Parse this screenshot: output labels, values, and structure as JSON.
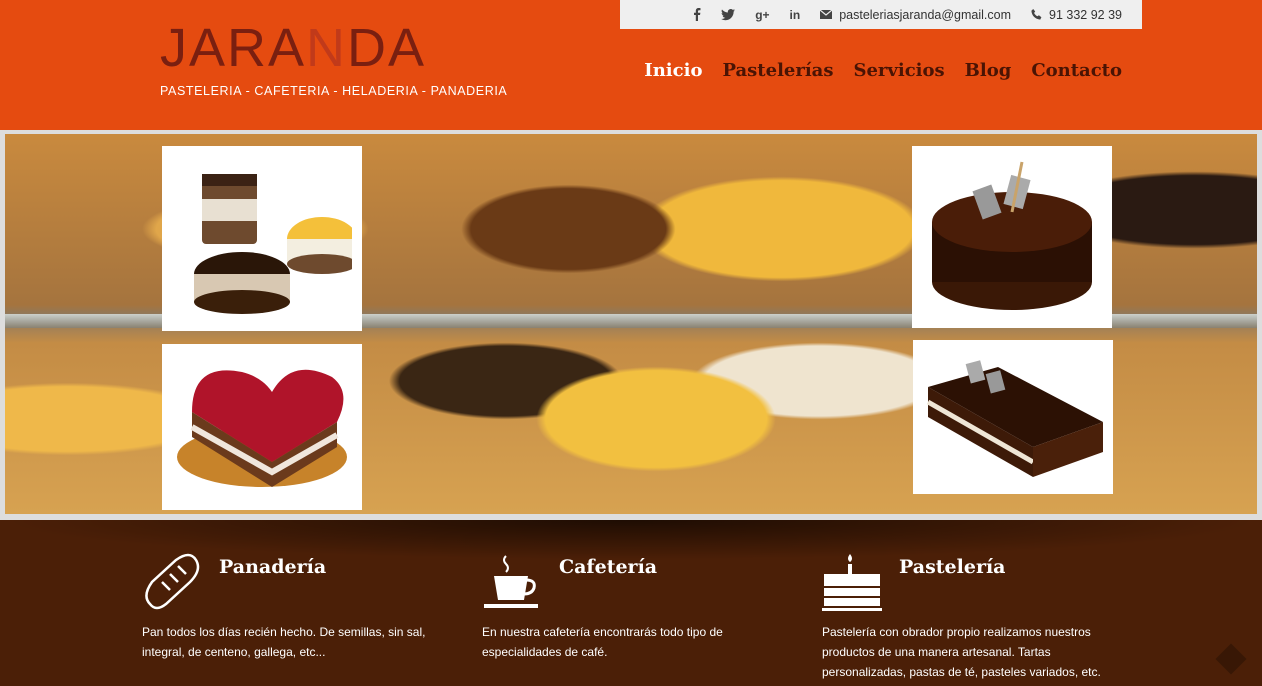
{
  "brand": {
    "name_left": "JARA",
    "name_mid": "N",
    "name_right": "DA",
    "tagline": "PASTELERIA - CAFETERIA - HELADERIA - PANADERIA"
  },
  "topbar": {
    "social": [
      "facebook-icon",
      "twitter-icon",
      "googleplus-icon",
      "linkedin-icon"
    ],
    "googleplus_label": "g+",
    "linkedin_label": "in",
    "email": "pasteleriasjaranda@gmail.com",
    "phone": "91 332 92 39"
  },
  "nav": {
    "items": [
      "Inicio",
      "Pastelerías",
      "Servicios",
      "Blog",
      "Contacto"
    ],
    "active": "Inicio"
  },
  "features": [
    {
      "icon": "bread-icon",
      "title": "Panadería",
      "text": "Pan todos los días recién hecho. De semillas, sin sal, integral, de centeno, gallega, etc..."
    },
    {
      "icon": "coffee-cup-icon",
      "title": "Cafetería",
      "text": "En nuestra cafetería encontrarás todo tipo de especialidades de café."
    },
    {
      "icon": "cake-icon",
      "title": "Pastelería",
      "text": "Pastelería con obrador propio realizamos nuestros productos de una manera artesanal. Tartas personalizadas, pastas de té, pasteles variados, etc."
    }
  ],
  "colors": {
    "header": "#e54b10",
    "nav_text": "#4a1404",
    "footer": "#4b1f07"
  }
}
